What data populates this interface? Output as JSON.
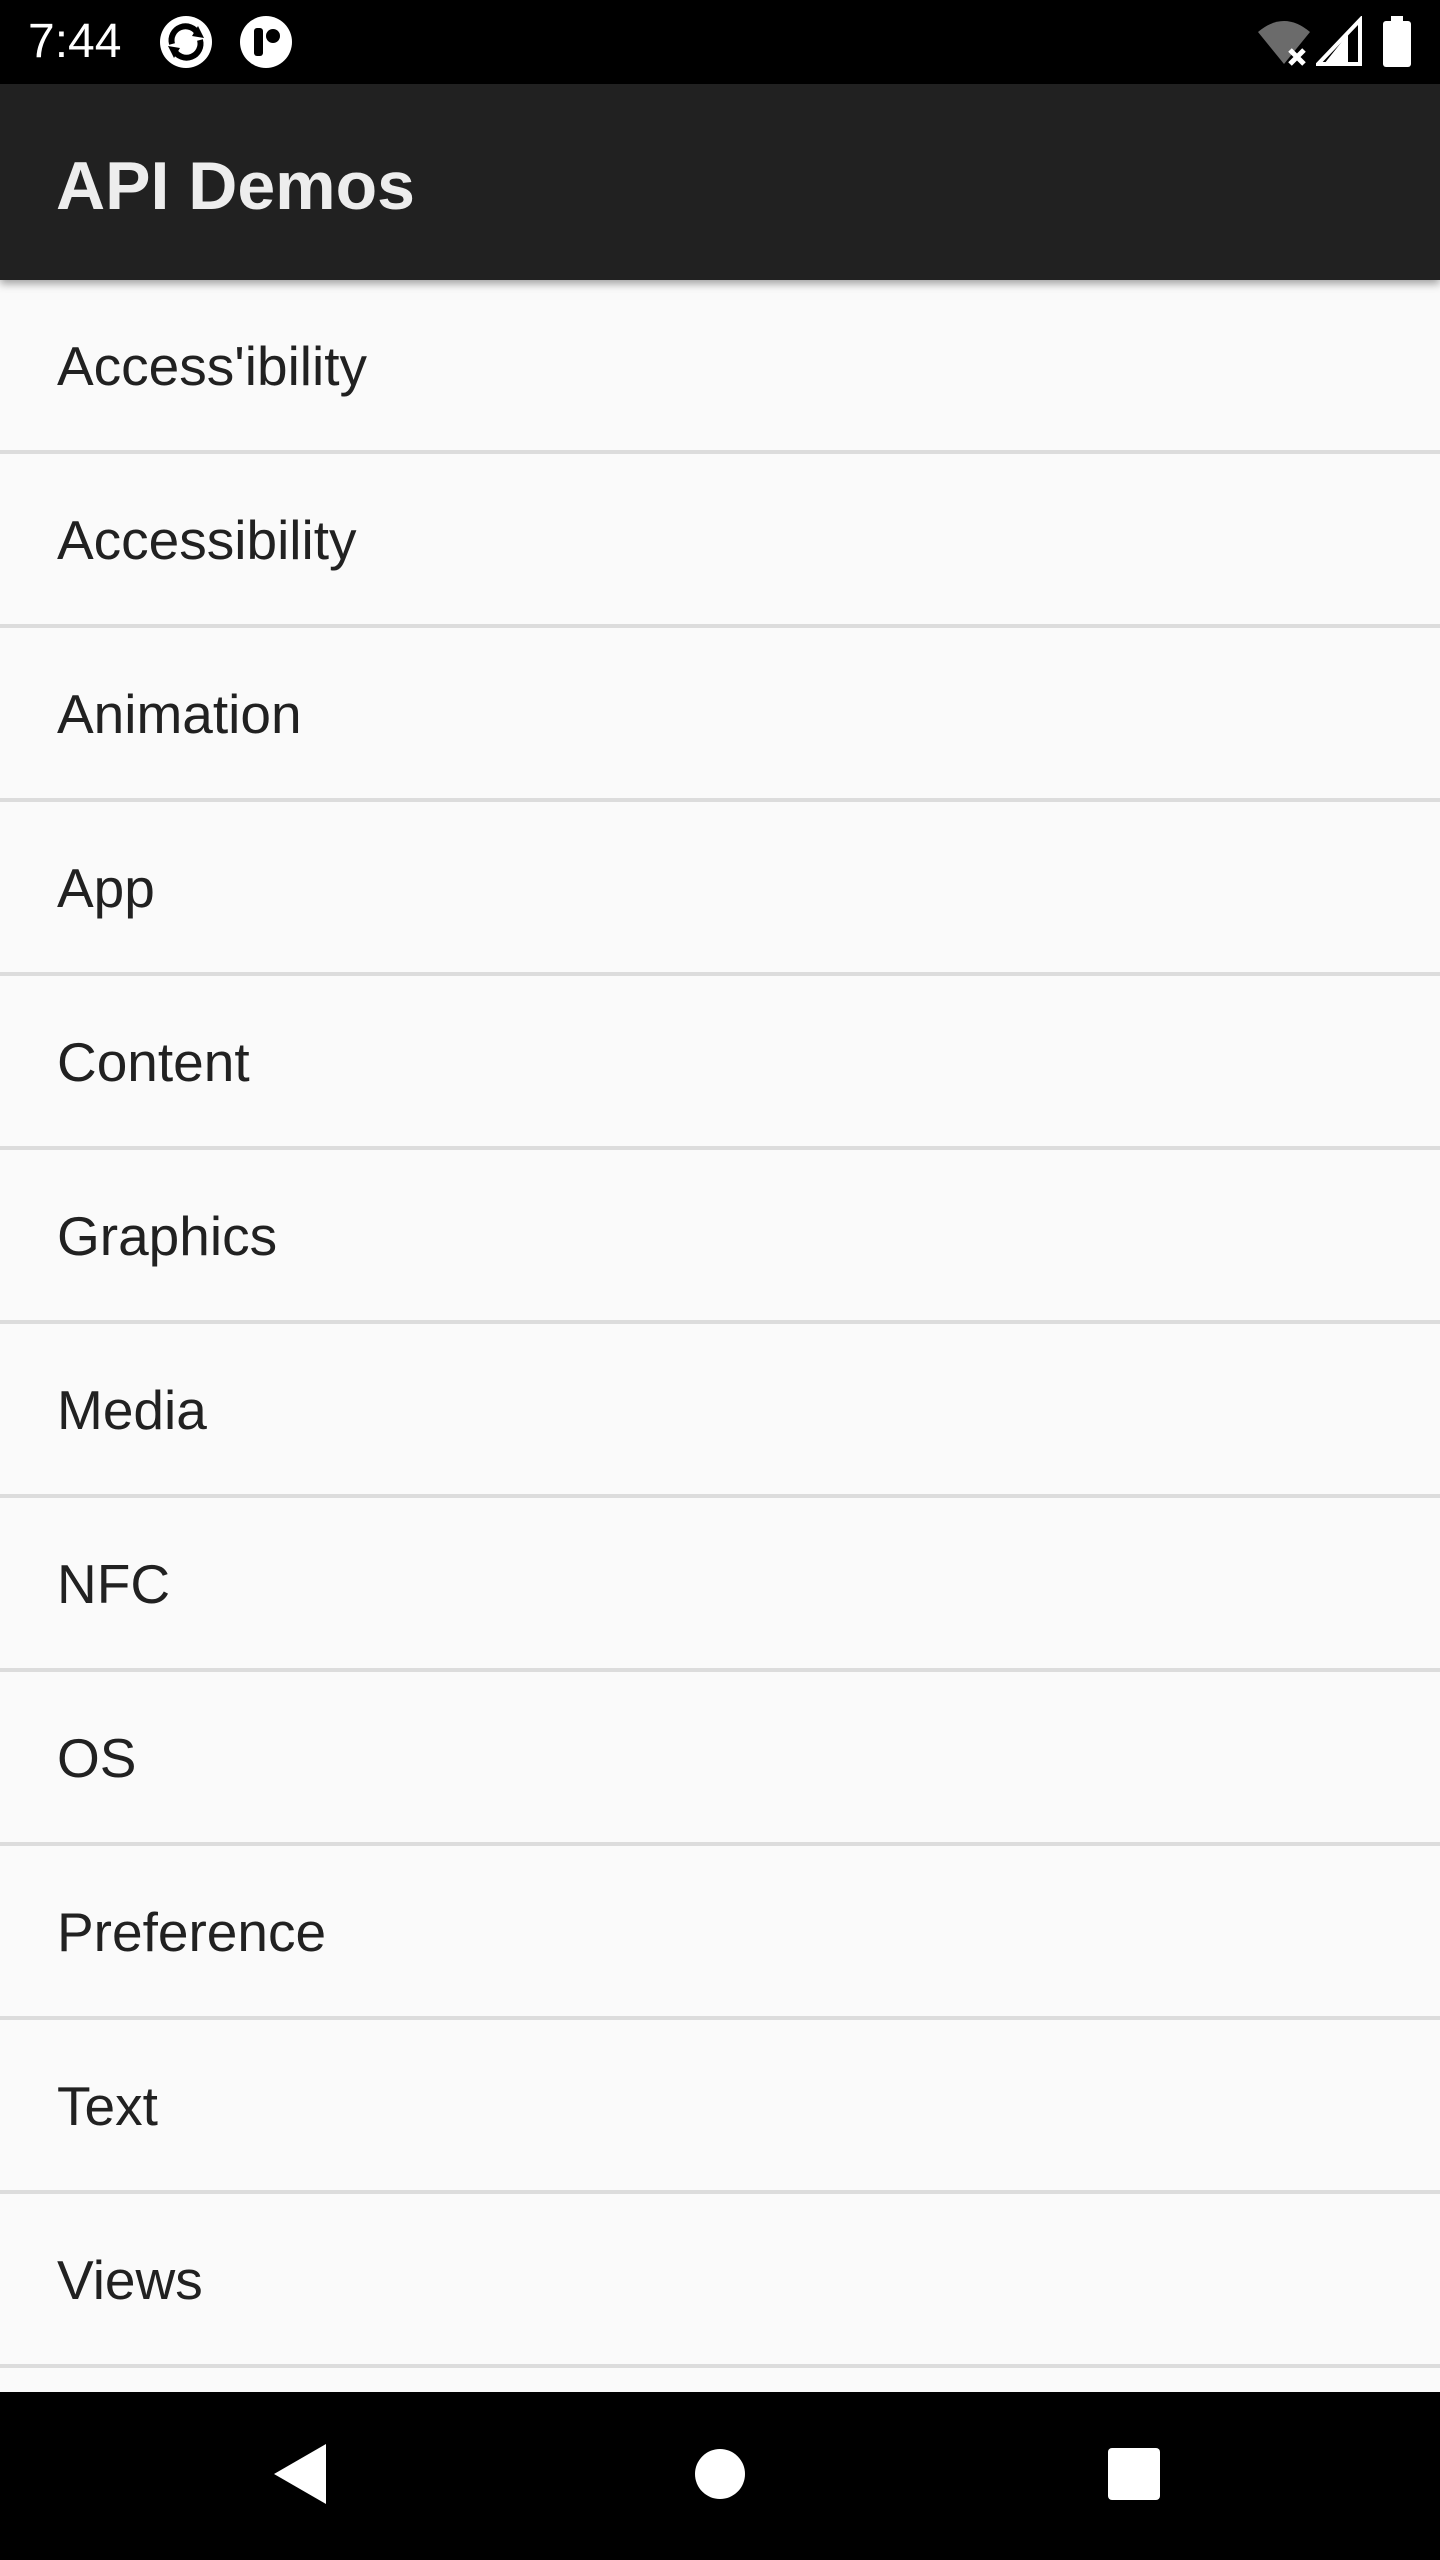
{
  "status_bar": {
    "time": "7:44",
    "app_icons": [
      "sync-icon",
      "notification-app-icon"
    ],
    "right_icons": [
      "wifi-off-icon",
      "cell-signal-icon",
      "battery-icon"
    ]
  },
  "app_bar": {
    "title": "API Demos"
  },
  "list": {
    "items": [
      {
        "label": "Access'ibility"
      },
      {
        "label": "Accessibility"
      },
      {
        "label": "Animation"
      },
      {
        "label": "App"
      },
      {
        "label": "Content"
      },
      {
        "label": "Graphics"
      },
      {
        "label": "Media"
      },
      {
        "label": "NFC"
      },
      {
        "label": "OS"
      },
      {
        "label": "Preference"
      },
      {
        "label": "Text"
      },
      {
        "label": "Views"
      }
    ]
  },
  "nav_bar": {
    "buttons": [
      "back-icon",
      "home-icon",
      "recents-icon"
    ]
  },
  "colors": {
    "status_bar": "#000000",
    "app_bar": "#212121",
    "list_background": "#fafafa",
    "divider": "#dcdcdc",
    "text": "#212121"
  }
}
